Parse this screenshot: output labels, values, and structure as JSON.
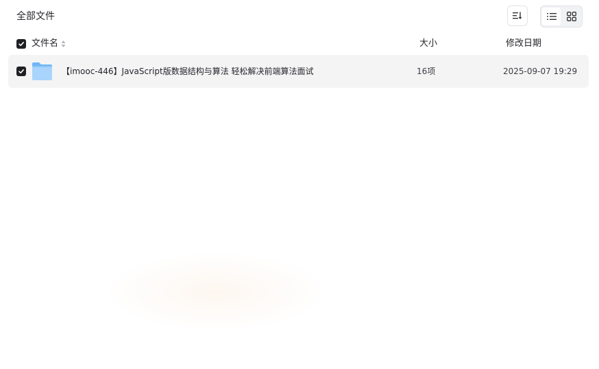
{
  "breadcrumb": {
    "title": "全部文件"
  },
  "toolbar": {
    "sort_icon": "sort-descending-icon",
    "view_list_icon": "list-view-icon",
    "view_grid_icon": "grid-view-icon",
    "active_view": "list"
  },
  "table": {
    "columns": {
      "name": "文件名",
      "size": "大小",
      "modified": "修改日期"
    },
    "select_all_checked": true,
    "rows": [
      {
        "icon": "folder-icon",
        "name": "【imooc-446】JavaScript版数据结构与算法 轻松解决前端算法面试",
        "size": "16项",
        "modified": "2025-09-07 19:29",
        "checked": true
      }
    ]
  },
  "colors": {
    "checkbox": "#1f2023",
    "row_bg": "#f4f4f5",
    "folder_light": "#a9d4fb",
    "folder_dark": "#6fb6f6"
  }
}
